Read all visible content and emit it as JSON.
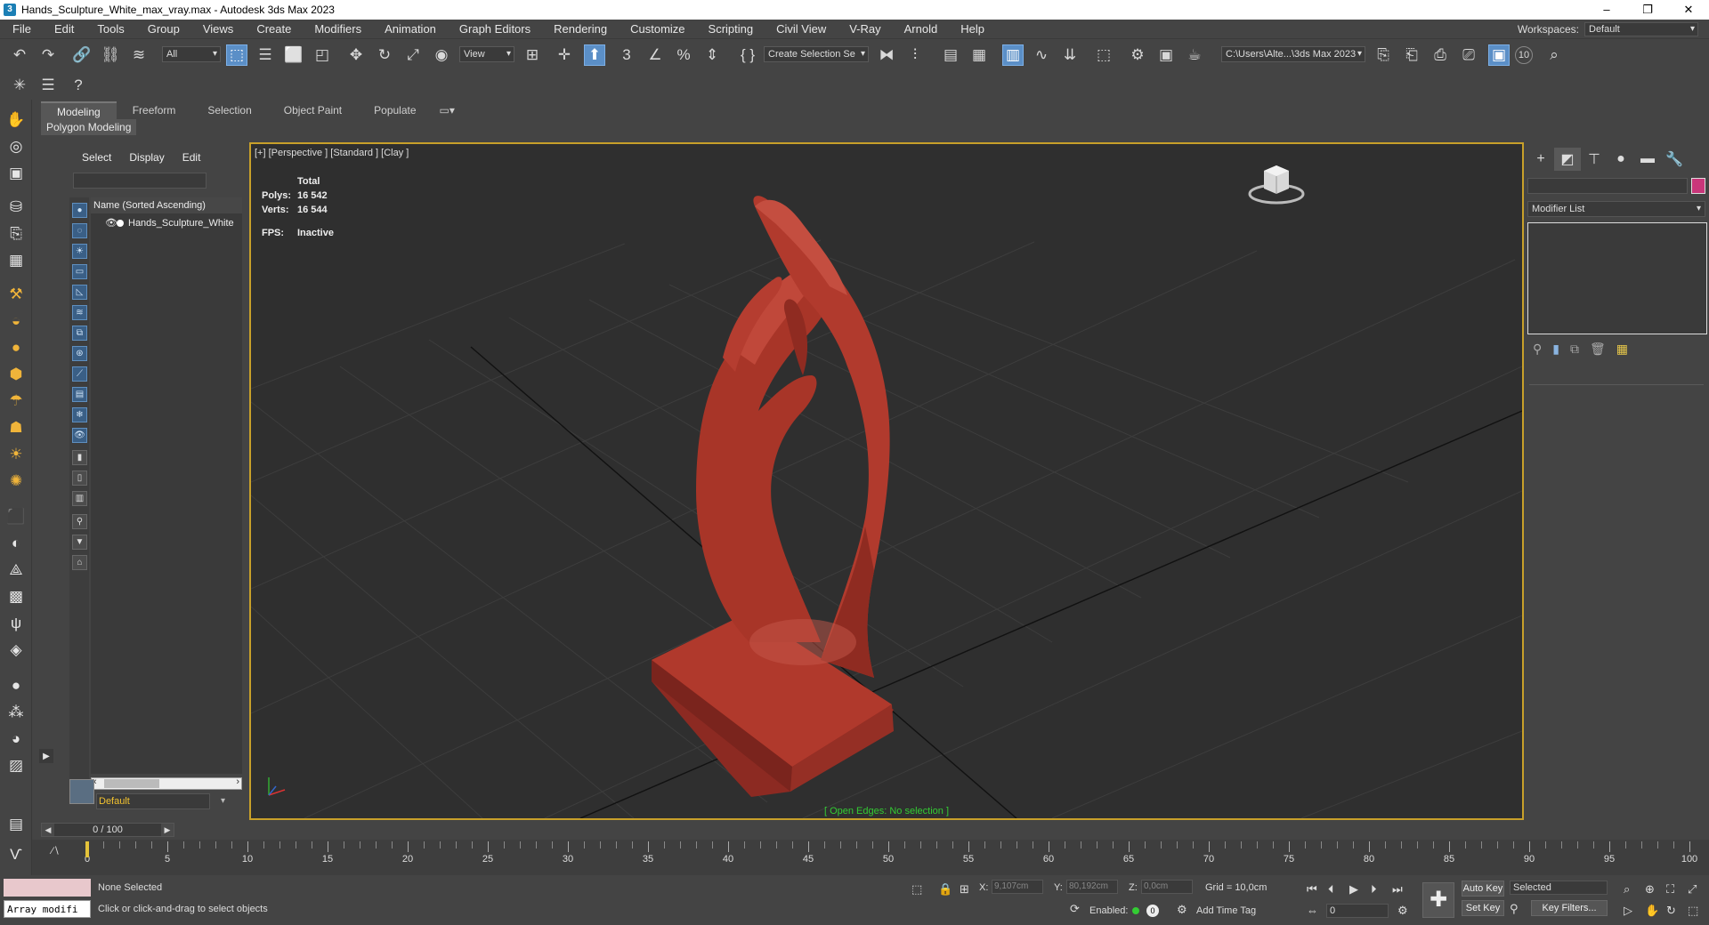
{
  "window": {
    "title": "Hands_Sculpture_White_max_vray.max - Autodesk 3ds Max 2023",
    "app_icon": "3"
  },
  "menu": [
    "File",
    "Edit",
    "Tools",
    "Group",
    "Views",
    "Create",
    "Modifiers",
    "Animation",
    "Graph Editors",
    "Rendering",
    "Customize",
    "Scripting",
    "Civil View",
    "V-Ray",
    "Arnold",
    "Help"
  ],
  "workspace": {
    "label": "Workspaces:",
    "value": "Default"
  },
  "toolbar": {
    "filter_value": "All",
    "refcoord_value": "View",
    "selection_set_value": "Create Selection Se",
    "project_path": "C:\\Users\\Alte...\\3ds Max 2023",
    "badge_10": "10"
  },
  "ribbon": {
    "tabs": [
      "Modeling",
      "Freeform",
      "Selection",
      "Object Paint",
      "Populate"
    ],
    "sub_label": "Polygon Modeling"
  },
  "explorer": {
    "tabs": [
      "Select",
      "Display",
      "Edit"
    ],
    "column_header": "Name (Sorted Ascending)",
    "items": [
      "Hands_Sculpture_White"
    ],
    "layer": "Default"
  },
  "viewport": {
    "label": "[+] [Perspective ] [Standard ] [Clay ]",
    "stats_header": "Total",
    "polys_label": "Polys:",
    "polys_value": "16 542",
    "verts_label": "Verts:",
    "verts_value": "16 544",
    "fps_label": "FPS:",
    "fps_value": "Inactive",
    "status": "[ Open Edges: No selection ]",
    "object_color": "#b0392c"
  },
  "cmdpanel": {
    "modifier_list": "Modifier List",
    "object_color": "#c9367a"
  },
  "timeslider": {
    "value": "0 / 100"
  },
  "trackbar": {
    "ticks": [
      "0",
      "5",
      "10",
      "15",
      "20",
      "25",
      "30",
      "35",
      "40",
      "45",
      "50",
      "55",
      "60",
      "65",
      "70",
      "75",
      "80",
      "85",
      "90",
      "95",
      "100"
    ]
  },
  "statusbar": {
    "maxscript": "Array modifi",
    "selection_status": "None Selected",
    "prompt": "Click or click-and-drag to select objects",
    "x_label": "X:",
    "x_value": "9,107cm",
    "y_label": "Y:",
    "y_value": "80,192cm",
    "z_label": "Z:",
    "z_value": "0,0cm",
    "grid": "Grid = 10,0cm",
    "enabled_label": "Enabled:",
    "add_time_tag": "Add Time Tag",
    "auto_key": "Auto Key",
    "set_key": "Set Key",
    "key_mode": "Selected",
    "key_filters": "Key Filters...",
    "frame_value": "0"
  }
}
